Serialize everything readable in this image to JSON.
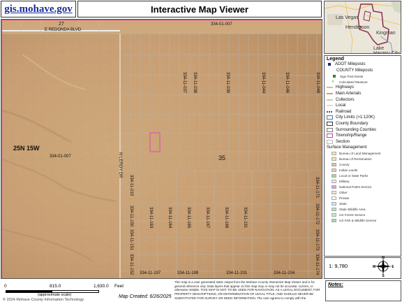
{
  "header": {
    "site_link": "gis.mohave.gov",
    "title": "Interactive Map Viewer"
  },
  "map": {
    "road_top": "E REDONDA BLVD",
    "section_top_left": "27",
    "parcel_top": "334-01-007",
    "parcel_left": "334-01-007",
    "township": "25N 15W",
    "road_vertical": "N LEROY DR",
    "section_center": "35",
    "parcels_top_row": [
      "334-11-037",
      "334-11-038",
      "334-11-039",
      "334-11-044",
      "334-11-046",
      "334-11-048"
    ],
    "parcels_left_col": [
      "334-11-010",
      "334-11-150",
      "334-11-151",
      "334-11-152"
    ],
    "parcels_middle": [
      "334-11-163",
      "334-11-164",
      "334-11-165",
      "334-11-167",
      "334-11-168",
      "334-11-191"
    ],
    "parcels_right_col": [
      "334-11-171",
      "334-11-172",
      "334-11-173",
      "334-11-174"
    ],
    "parcels_bottom": [
      "334-11-197",
      "334-11-199",
      "334-11-201",
      "334-11-204"
    ]
  },
  "overview": {
    "labels": [
      "Las Vegas",
      "Henderson",
      "Kingman",
      "Lake Havasu City"
    ]
  },
  "legend": {
    "title": "Legend",
    "items": [
      {
        "label": "ADOT Mileposts",
        "swatch": "square-navy",
        "color": "#1b2b7a"
      },
      {
        "label": "COUNTY Mileposts",
        "swatch": "none",
        "indent": true
      },
      {
        "label": "Sign Post Exists",
        "swatch": "square-green",
        "color": "#2e8b2e",
        "small": true
      },
      {
        "label": "Calculated Measure",
        "swatch": "x-green",
        "color": "#5aa05a",
        "small": true
      },
      {
        "label": "Highways",
        "swatch": "line",
        "color": "#e8b96a"
      },
      {
        "label": "Main Arterials",
        "swatch": "line",
        "color": "#bfa76d"
      },
      {
        "label": "Collectors",
        "swatch": "line",
        "color": "#d8c79a"
      },
      {
        "label": "Local",
        "swatch": "line",
        "color": "#dedede"
      },
      {
        "label": "Railroad",
        "swatch": "rail",
        "color": "#555555"
      },
      {
        "label": "City Limits (>1:120K)",
        "swatch": "box",
        "color": "#4a7a9a"
      },
      {
        "label": "County Boundary",
        "swatch": "box",
        "color": "#333333"
      },
      {
        "label": "Surrounding Counties",
        "swatch": "box",
        "color": "#777777"
      },
      {
        "label": "Township/Range",
        "swatch": "box",
        "color": "#c04a9a"
      },
      {
        "label": "Section",
        "swatch": "box",
        "color": "#bbbbbb"
      },
      {
        "label": "Surface Management",
        "swatch": "none"
      },
      {
        "label": "Bureau of Land Management",
        "swatch": "fill",
        "color": "#f6e7a3",
        "small": true
      },
      {
        "label": "Bureau of Reclamation",
        "swatch": "fill",
        "color": "#f0e2c6",
        "small": true
      },
      {
        "label": "County",
        "swatch": "fill",
        "color": "#c9c9a8",
        "small": true
      },
      {
        "label": "Indian Lands",
        "swatch": "fill",
        "color": "#f2c9a6",
        "small": true
      },
      {
        "label": "Local or State Parks",
        "swatch": "fill",
        "color": "#a3d9a3",
        "small": true
      },
      {
        "label": "Military",
        "swatch": "hatch",
        "color": "#c59ad1",
        "small": true
      },
      {
        "label": "National Parks Service",
        "swatch": "fill",
        "color": "#d8a7cf",
        "small": true
      },
      {
        "label": "Other",
        "swatch": "hatch",
        "color": "#b59a6a",
        "small": true
      },
      {
        "label": "Private",
        "swatch": "fill",
        "color": "#ffffff",
        "small": true
      },
      {
        "label": "State",
        "swatch": "fill",
        "color": "#cfe6f5",
        "small": true
      },
      {
        "label": "State Wildlife Area",
        "swatch": "fill",
        "color": "#b8e0c8",
        "small": true
      },
      {
        "label": "US Forest Service",
        "swatch": "fill",
        "color": "#cdebb8",
        "small": true
      },
      {
        "label": "US Fish & Wildlife Service",
        "swatch": "fill",
        "color": "#9fd5c8",
        "small": true
      }
    ]
  },
  "scale": {
    "ratio": "1: 9,780",
    "north_letters": [
      "N",
      "S",
      "E",
      "W"
    ]
  },
  "scalebar": {
    "n0": "0",
    "n1": "815.0",
    "n2": "1,630.0",
    "unit": "Feet",
    "approx": "(approximate scale)",
    "copyright": "© 2024 Mohave County Information Technology"
  },
  "created": "Map Created: 6/26/2025",
  "disclaimer": "This map is a user generated static output from the Mohave County Interactive Map Viewer and is for general reference only. Data layers that appear on this map may or may not be accurate, current, or otherwise reliable. THIS MAP IS NOT TO BE USED FOR NAVIGATION, AS A LEGAL DOCUMENT, FOR PROPERTY DESCRIPTIONS, OR DETERMINATION OF LEGAL TITLE, AND SHOULD NEVER BE SUBSTITUTED FOR SURVEY OR DEED INFORMATION. The user agrees to comply with the",
  "notes_label": "Notes:"
}
